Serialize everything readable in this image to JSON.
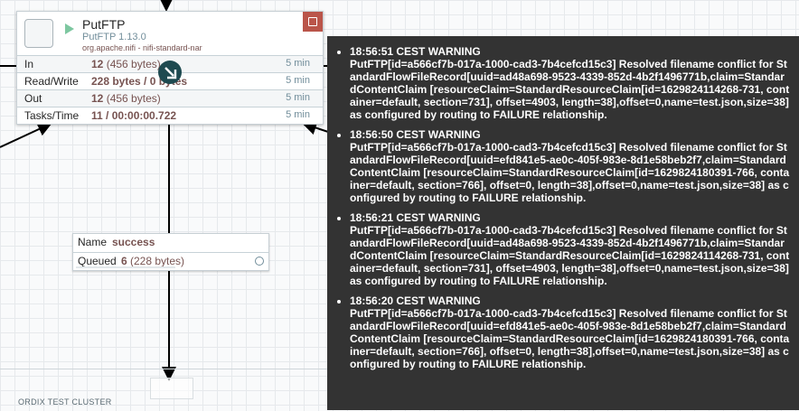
{
  "processor": {
    "name": "PutFTP",
    "type": "PutFTP 1.13.0",
    "bundle": "org.apache.nifi - nifi-standard-nar",
    "stats": [
      {
        "label": "In",
        "value": "12",
        "paren": "(456 bytes)",
        "time": "5 min"
      },
      {
        "label": "Read/Write",
        "value": "228 bytes / 0 bytes",
        "paren": "",
        "time": "5 min"
      },
      {
        "label": "Out",
        "value": "12",
        "paren": "(456 bytes)",
        "time": "5 min"
      },
      {
        "label": "Tasks/Time",
        "value": "11 / 00:00:00.722",
        "paren": "",
        "time": "5 min"
      }
    ]
  },
  "connection": {
    "name_label": "Name",
    "name_value": "success",
    "queued_label": "Queued",
    "queued_count": "6",
    "queued_paren": "(228 bytes)"
  },
  "cluster": {
    "label": "ORDIX TEST CLUSTER"
  },
  "bulletins": [
    {
      "text": "18:56:51 CEST  WARNING\nPutFTP[id=a566cf7b-017a-1000-cad3-7b4cefcd15c3] Resolved filename conflict for StandardFlowFileRecord[uuid=ad48a698-9523-4339-852d-4b2f1496771b,claim=StandardContentClaim [resourceClaim=StandardResourceClaim[id=1629824114268-731, container=default, section=731], offset=4903, length=38],offset=0,name=test.json,size=38] as configured by routing to FAILURE relationship."
    },
    {
      "text": "18:56:50 CEST  WARNING\nPutFTP[id=a566cf7b-017a-1000-cad3-7b4cefcd15c3] Resolved filename conflict for StandardFlowFileRecord[uuid=efd841e5-ae0c-405f-983e-8d1e58beb2f7,claim=StandardContentClaim [resourceClaim=StandardResourceClaim[id=1629824180391-766, container=default, section=766], offset=0, length=38],offset=0,name=test.json,size=38] as configured by routing to FAILURE relationship."
    },
    {
      "text": "18:56:21 CEST  WARNING\nPutFTP[id=a566cf7b-017a-1000-cad3-7b4cefcd15c3] Resolved filename conflict for StandardFlowFileRecord[uuid=ad48a698-9523-4339-852d-4b2f1496771b,claim=StandardContentClaim [resourceClaim=StandardResourceClaim[id=1629824114268-731, container=default, section=731], offset=4903, length=38],offset=0,name=test.json,size=38] as configured by routing to FAILURE relationship."
    },
    {
      "text": "18:56:20 CEST  WARNING\nPutFTP[id=a566cf7b-017a-1000-cad3-7b4cefcd15c3] Resolved filename conflict for StandardFlowFileRecord[uuid=efd841e5-ae0c-405f-983e-8d1e58beb2f7,claim=StandardContentClaim [resourceClaim=StandardResourceClaim[id=1629824180391-766, container=default, section=766], offset=0, length=38],offset=0,name=test.json,size=38] as configured by routing to FAILURE relationship."
    }
  ]
}
